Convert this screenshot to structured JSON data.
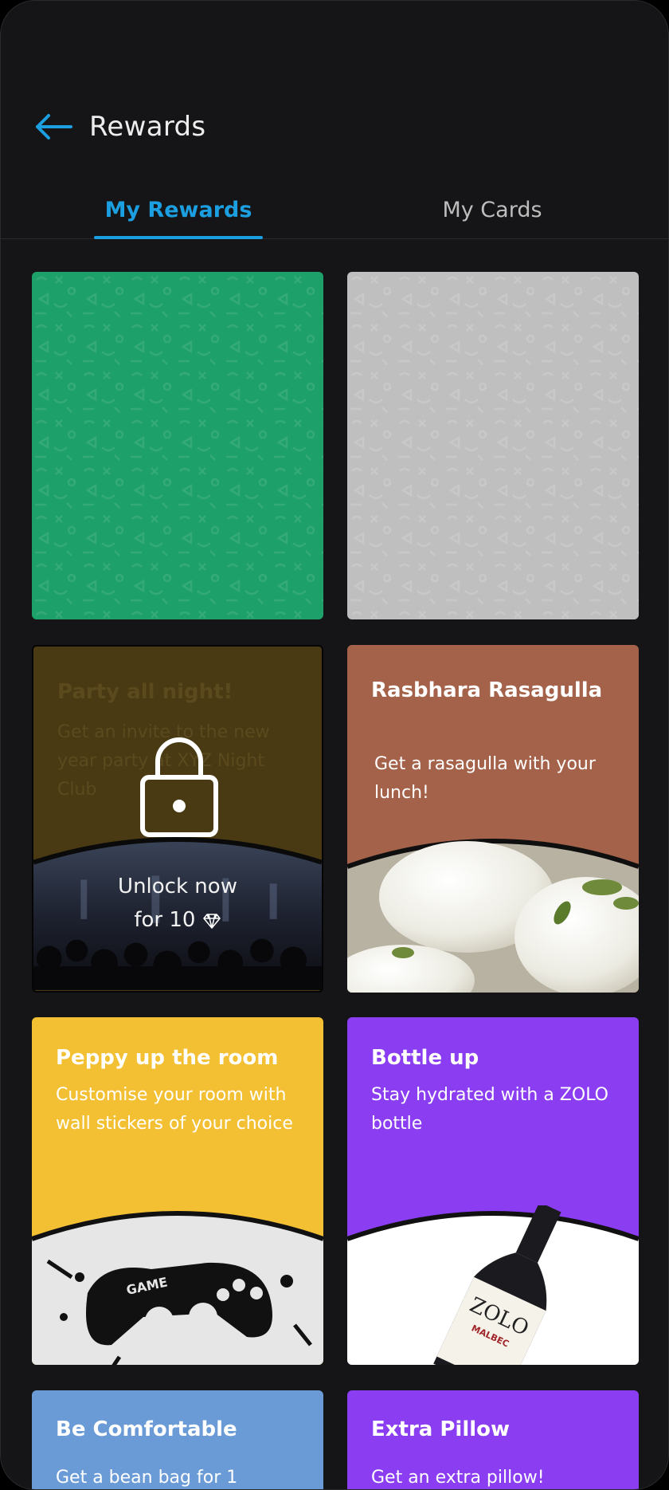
{
  "header": {
    "title": "Rewards",
    "back_icon": "arrow-left-icon"
  },
  "tabs": [
    {
      "label": "My Rewards",
      "active": true
    },
    {
      "label": "My Cards",
      "active": false
    }
  ],
  "colors": {
    "accent": "#1c9fe0",
    "background": "#151517",
    "scratch_green": "#1ea06a",
    "scratch_grey": "#bfbfbf"
  },
  "rewards": [
    {
      "kind": "scratch-card",
      "color": "#1ea06a"
    },
    {
      "kind": "scratch-card",
      "color": "#bfbfbf"
    },
    {
      "kind": "locked",
      "title": "Party all night!",
      "description": "Get an invite to the new year party at XYZ Night Club",
      "unlock_label": "Unlock now",
      "unlock_cost_prefix": "for 10",
      "cost_icon": "diamond-icon",
      "lock_icon": "lock-icon",
      "image": "night-club-crowd"
    },
    {
      "kind": "reward",
      "title": "Rasbhara Rasagulla",
      "description": "Get a rasagulla with your lunch!",
      "image": "rasagulla-dessert",
      "color": "#a5624a"
    },
    {
      "kind": "reward",
      "title": "Peppy up the room",
      "description": "Customise your room with wall stickers of your choice",
      "image": "game-controller-sticker",
      "color": "#f3c033"
    },
    {
      "kind": "reward",
      "title": "Bottle up",
      "description": "Stay hydrated with a ZOLO bottle",
      "image": "zolo-bottle",
      "bottle_label": "ZOLO",
      "bottle_sublabel": "MALBEC",
      "color": "#8b3df2"
    },
    {
      "kind": "reward",
      "title": "Be Comfortable",
      "description": "Get a bean bag for 1",
      "color": "#6a9bd6"
    },
    {
      "kind": "reward",
      "title": "Extra Pillow",
      "description": "Get an extra pillow!",
      "color": "#8b3df2"
    }
  ]
}
